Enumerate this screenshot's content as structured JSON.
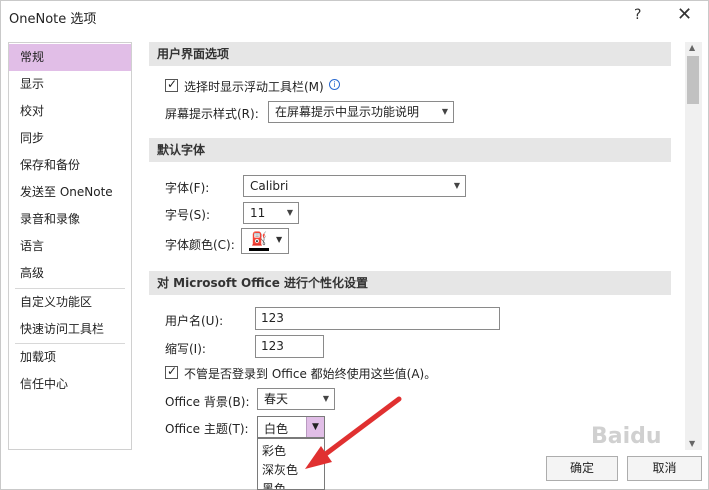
{
  "window": {
    "title": "OneNote 选项",
    "help": "?",
    "close": "✕"
  },
  "sidebar": {
    "items": [
      "常规",
      "显示",
      "校对",
      "同步",
      "保存和备份",
      "发送至 OneNote",
      "录音和录像",
      "语言",
      "高级",
      "自定义功能区",
      "快速访问工具栏",
      "加载项",
      "信任中心"
    ],
    "active_index": 0
  },
  "sections": {
    "ui": {
      "header": "用户界面选项",
      "mini_toolbar_label": "选择时显示浮动工具栏(M)",
      "mini_toolbar_checked": true,
      "screentip_label": "屏幕提示样式(R):",
      "screentip_value": "在屏幕提示中显示功能说明"
    },
    "font": {
      "header": "默认字体",
      "font_label": "字体(F):",
      "font_value": "Calibri",
      "size_label": "字号(S):",
      "size_value": "11",
      "color_label": "字体颜色(C):"
    },
    "personalize": {
      "header": "对 Microsoft Office 进行个性化设置",
      "username_label": "用户名(U):",
      "username_value": "123",
      "initials_label": "缩写(I):",
      "initials_value": "123",
      "always_use_label": "不管是否登录到 Office 都始终使用这些值(A)。",
      "always_use_checked": true,
      "background_label": "Office 背景(B):",
      "background_value": "春天",
      "theme_label": "Office 主题(T):",
      "theme_value": "白色",
      "theme_options": [
        "彩色",
        "深灰色",
        "黑色"
      ]
    }
  },
  "buttons": {
    "ok": "确定",
    "cancel": "取消"
  },
  "watermark": "Baidu",
  "colors": {
    "accent": "#e1bee7",
    "annotation_arrow": "#e03030"
  }
}
